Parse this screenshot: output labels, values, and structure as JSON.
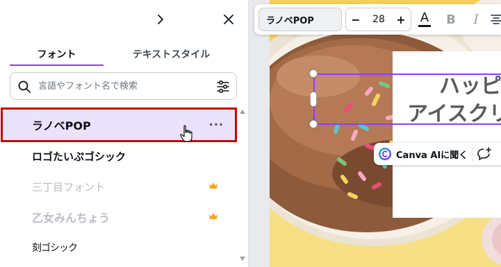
{
  "panel": {
    "tabs": [
      {
        "label": "フォント",
        "active": true
      },
      {
        "label": "テキストスタイル",
        "active": false
      }
    ],
    "search": {
      "placeholder": "言語やフォント名で検索",
      "value": ""
    },
    "fonts": [
      {
        "name": "ラノベPOP",
        "selected": true,
        "more_label": "···",
        "pro": false
      },
      {
        "name": "ロゴたいぷゴシック",
        "selected": false,
        "pro": false
      },
      {
        "name": "三丁目フォント",
        "selected": false,
        "pro": true
      },
      {
        "name": "乙女みんちょう",
        "selected": false,
        "pro": true
      },
      {
        "name": "刻ゴシック",
        "selected": false,
        "pro": false
      }
    ]
  },
  "toolbar": {
    "font_name": "ラノベPOP",
    "font_size": "28",
    "minus_label": "−",
    "plus_label": "+",
    "text_color_label": "A",
    "bold_label": "B",
    "italic_label": "I"
  },
  "design": {
    "line1": "ハッピ",
    "line2": "アイスクリ"
  },
  "ai_popup": {
    "label": "Canva AIに聞く"
  },
  "colors": {
    "accent": "#8b3dff",
    "selected_bg": "#ebe3fd",
    "highlight_border": "#c00000",
    "crown": "#f5a623",
    "background_yellow": "#f3d15a"
  },
  "icons": {
    "expand": "chevron-right-icon",
    "close": "close-icon",
    "search": "search-icon",
    "filter": "filter-sliders-icon",
    "more": "more-horizontal-icon",
    "pro": "crown-icon",
    "pointer": "hand-pointer-icon",
    "ai": "canva-ai-icon",
    "comment": "add-comment-icon",
    "align": "align-center-icon"
  }
}
